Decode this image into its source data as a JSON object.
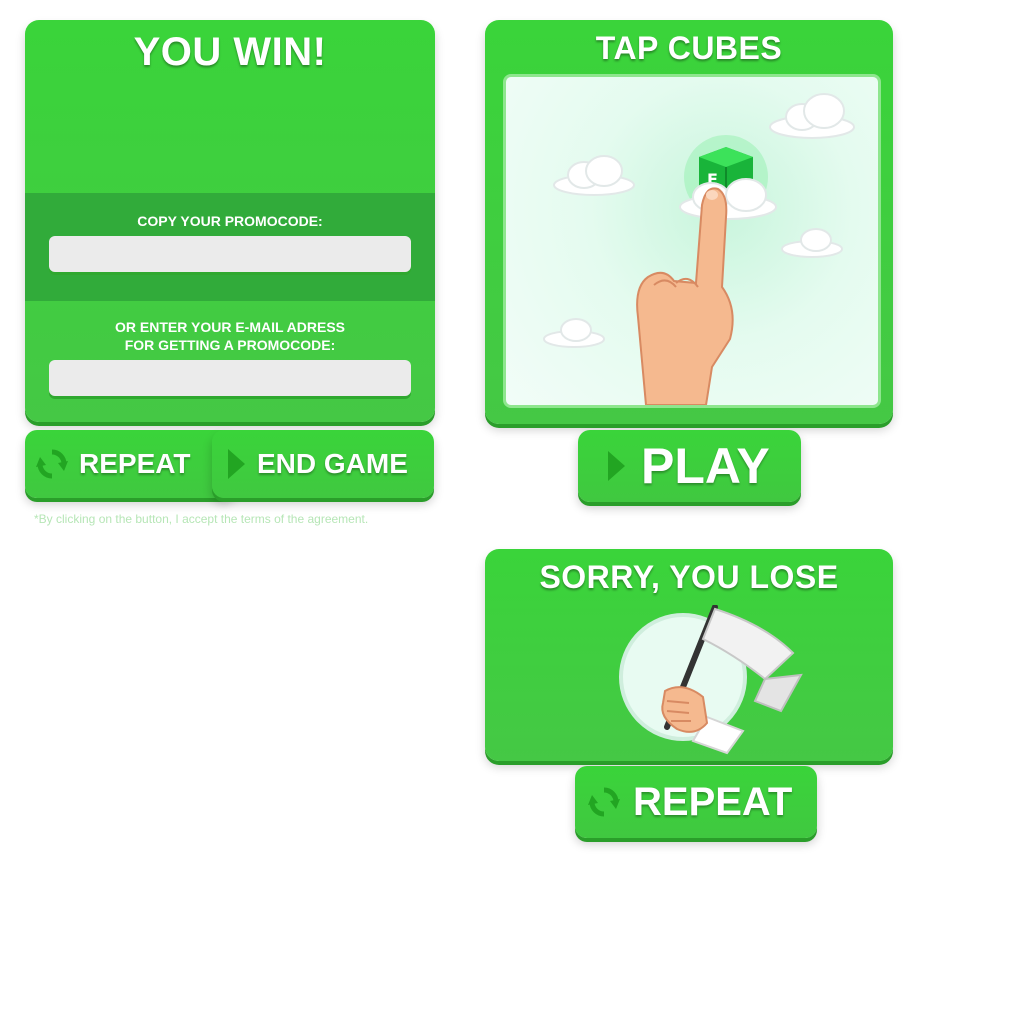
{
  "win_panel": {
    "title": "YOU WIN!",
    "copy_label": "COPY YOUR PROMOCODE:",
    "promocode_value": "",
    "email_label_line1": "OR ENTER YOUR E-MAIL ADRESS",
    "email_label_line2": "FOR GETTING A PROMOCODE:",
    "email_value": ""
  },
  "win_buttons": {
    "repeat_label": "REPEAT",
    "end_game_label": "END GAME"
  },
  "terms_text": "*By clicking on the button, I accept the terms of the agreement.",
  "start_panel": {
    "title": "TAP CUBES",
    "play_label": "PLAY"
  },
  "lose_panel": {
    "title": "SORRY, YOU LOSE",
    "repeat_label": "REPEAT"
  },
  "colors": {
    "panel_green": "#3ad43a",
    "panel_shadow": "#2a9e2a",
    "band_green": "#2fa83a",
    "field_gray": "#ebebeb"
  }
}
